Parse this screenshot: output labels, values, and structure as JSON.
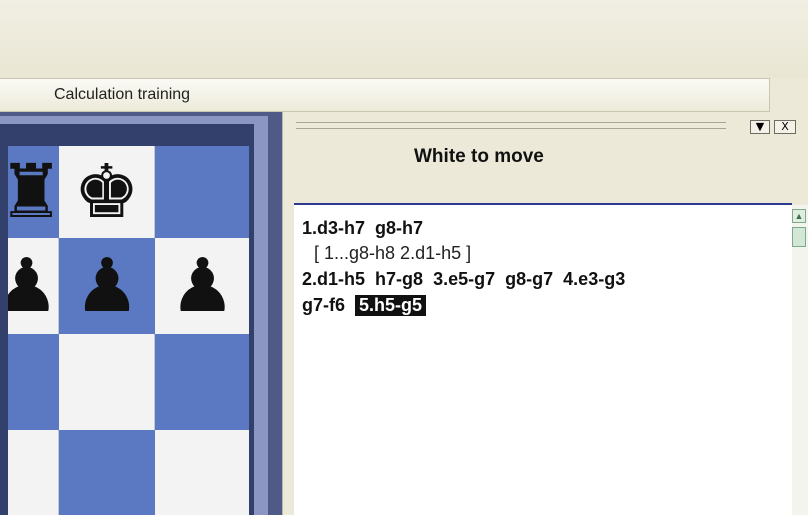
{
  "tab": {
    "label": "Calculation training"
  },
  "panel": {
    "title": "White to move",
    "buttons": {
      "dropdown": "▼",
      "close": "X"
    },
    "notation": {
      "line1": {
        "m1w": "1.d3-h7",
        "m1b": "g8-h7"
      },
      "variation": "[ 1...g8-h8  2.d1-h5 ]",
      "line3": {
        "m2w": "2.d1-h5",
        "m2b": "h7-g8",
        "m3w": "3.e5-g7",
        "m3b": "g8-g7",
        "m4w": "4.e3-g3"
      },
      "line4": {
        "m4b": "g7-f6",
        "current": "5.h5-g5"
      }
    }
  },
  "board": {
    "pieces": {
      "rook": "♜",
      "king": "♚",
      "pawn1": "♟",
      "pawn2": "♟",
      "pawn3": "♟"
    }
  }
}
